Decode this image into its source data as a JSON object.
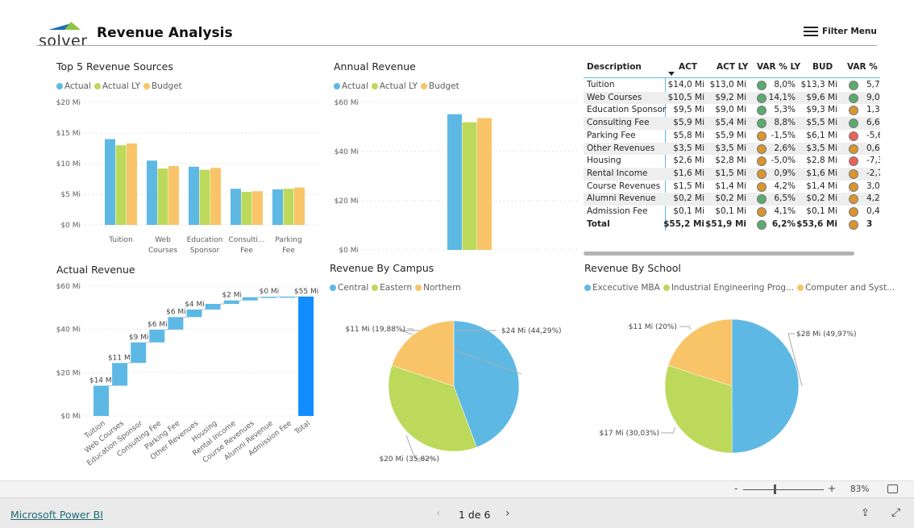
{
  "header": {
    "logo_text": "solver",
    "title": "Revenue Analysis",
    "filter_menu": "Filter Menu"
  },
  "colors": {
    "actual": "#5db9e4",
    "actual_ly": "#bdd95b",
    "budget": "#f9c468",
    "total": "#118dff",
    "green": "#5aab6e",
    "orange": "#d9952e",
    "red": "#e8635a"
  },
  "top5": {
    "title": "Top 5 Revenue Sources",
    "legend": [
      "Actual",
      "Actual LY",
      "Budget"
    ]
  },
  "annual": {
    "title": "Annual Revenue",
    "legend": [
      "Actual",
      "Actual LY",
      "Budget"
    ]
  },
  "waterfall": {
    "title": "Actual Revenue"
  },
  "campus": {
    "title": "Revenue By Campus",
    "legend": [
      "Central",
      "Eastern",
      "Northern"
    ]
  },
  "school": {
    "title": "Revenue By School",
    "legend": [
      "Excecutive MBA",
      "Industrial Engineering Prog...",
      "Computer and Syst..."
    ]
  },
  "chart_data": [
    {
      "type": "bar",
      "title": "Top 5 Revenue Sources",
      "categories": [
        [
          "Tuition"
        ],
        [
          "Web",
          "Courses"
        ],
        [
          "Education",
          "Sponsor"
        ],
        [
          "Consulti...",
          "Fee"
        ],
        [
          "Parking",
          "Fee"
        ]
      ],
      "series": [
        {
          "name": "Actual",
          "values": [
            14.0,
            10.5,
            9.5,
            5.9,
            5.8
          ]
        },
        {
          "name": "Actual LY",
          "values": [
            13.0,
            9.2,
            9.0,
            5.4,
            5.9
          ]
        },
        {
          "name": "Budget",
          "values": [
            13.3,
            9.6,
            9.3,
            5.5,
            6.1
          ]
        }
      ],
      "yticks": [
        "$0 Mi",
        "$5 Mi",
        "$10 Mi",
        "$15 Mi",
        "$20 Mi"
      ],
      "ylim": [
        0,
        20
      ],
      "grid": true,
      "legend": "top-left"
    },
    {
      "type": "bar",
      "title": "Annual Revenue",
      "categories": [
        ""
      ],
      "series": [
        {
          "name": "Actual",
          "values": [
            55.2
          ]
        },
        {
          "name": "Actual LY",
          "values": [
            51.9
          ]
        },
        {
          "name": "Budget",
          "values": [
            53.6
          ]
        }
      ],
      "yticks": [
        "$0 Mi",
        "$20 Mi",
        "$40 Mi",
        "$60 Mi"
      ],
      "ylim": [
        0,
        60
      ],
      "grid": true,
      "legend": "top-left"
    },
    {
      "type": "waterfall",
      "title": "Actual Revenue",
      "categories": [
        "Tuition",
        "Web Courses",
        "Education Sponsor",
        "Consulting Fee",
        "Parking Fee",
        "Other Revenues",
        "Housing",
        "Rental Income",
        "Course Revenues",
        "Alumni Revenue",
        "Admission Fee",
        "Total"
      ],
      "values": [
        14.0,
        10.5,
        9.5,
        5.9,
        5.8,
        3.5,
        2.6,
        1.6,
        1.5,
        0.2,
        0.1,
        55.2
      ],
      "labels": [
        "$14 Mi",
        "$11 Mi",
        "$9 Mi",
        "$6 Mi",
        "$6 Mi",
        "$4 Mi",
        "",
        "$2 Mi",
        "",
        "$0 Mi",
        "",
        "$55 Mi"
      ],
      "yticks": [
        "$0 Mi",
        "$20 Mi",
        "$40 Mi",
        "$60 Mi"
      ],
      "ylim": [
        0,
        60
      ],
      "grid": true
    },
    {
      "type": "pie",
      "title": "Revenue By Campus",
      "slices": [
        {
          "name": "Central",
          "value": 24,
          "percent": 44.29,
          "label": "$24 Mi (44,29%)"
        },
        {
          "name": "Eastern",
          "value": 20,
          "percent": 35.82,
          "label": "$20 Mi (35,82%)"
        },
        {
          "name": "Northern",
          "value": 11,
          "percent": 19.88,
          "label": "$11 Mi (19,88%)"
        }
      ],
      "legend": "top-left"
    },
    {
      "type": "pie",
      "title": "Revenue By School",
      "slices": [
        {
          "name": "Excecutive MBA",
          "value": 28,
          "percent": 49.97,
          "label": "$28 Mi (49,97%)"
        },
        {
          "name": "Industrial Engineering Prog...",
          "value": 17,
          "percent": 30.03,
          "label": "$17 Mi (30,03%)"
        },
        {
          "name": "Computer and Syst...",
          "value": 11,
          "percent": 20,
          "label": "$11 Mi (20%)"
        }
      ],
      "legend": "top-left"
    }
  ],
  "table": {
    "headers": [
      "Description",
      "ACT",
      "ACT LY",
      "VAR % LY",
      "BUD",
      "VAR % B"
    ],
    "rows": [
      {
        "desc": "Tuition",
        "act": "$14,0 Mi",
        "act_ly": "$13,0 Mi",
        "ly_status": "green",
        "var_ly": "8,0%",
        "bud": "$13,3 Mi",
        "b_status": "green",
        "var_b": "5,7"
      },
      {
        "desc": "Web Courses",
        "act": "$10,5 Mi",
        "act_ly": "$9,2 Mi",
        "ly_status": "green",
        "var_ly": "14,1%",
        "bud": "$9,6 Mi",
        "b_status": "green",
        "var_b": "9,0"
      },
      {
        "desc": "Education Sponsor",
        "act": "$9,5 Mi",
        "act_ly": "$9,0 Mi",
        "ly_status": "green",
        "var_ly": "5,3%",
        "bud": "$9,3 Mi",
        "b_status": "orange",
        "var_b": "1,3"
      },
      {
        "desc": "Consulting Fee",
        "act": "$5,9 Mi",
        "act_ly": "$5,4 Mi",
        "ly_status": "green",
        "var_ly": "8,8%",
        "bud": "$5,5 Mi",
        "b_status": "green",
        "var_b": "6,6"
      },
      {
        "desc": "Parking Fee",
        "act": "$5,8 Mi",
        "act_ly": "$5,9 Mi",
        "ly_status": "orange",
        "var_ly": "-1,5%",
        "bud": "$6,1 Mi",
        "b_status": "red",
        "var_b": "-5,6"
      },
      {
        "desc": "Other Revenues",
        "act": "$3,5 Mi",
        "act_ly": "$3,5 Mi",
        "ly_status": "orange",
        "var_ly": "2,6%",
        "bud": "$3,5 Mi",
        "b_status": "orange",
        "var_b": "0,6"
      },
      {
        "desc": "Housing",
        "act": "$2,6 Mi",
        "act_ly": "$2,8 Mi",
        "ly_status": "orange",
        "var_ly": "-5,0%",
        "bud": "$2,8 Mi",
        "b_status": "red",
        "var_b": "-7,3"
      },
      {
        "desc": "Rental Income",
        "act": "$1,6 Mi",
        "act_ly": "$1,5 Mi",
        "ly_status": "orange",
        "var_ly": "0,9%",
        "bud": "$1,6 Mi",
        "b_status": "orange",
        "var_b": "-2,7"
      },
      {
        "desc": "Course Revenues",
        "act": "$1,5 Mi",
        "act_ly": "$1,4 Mi",
        "ly_status": "orange",
        "var_ly": "4,2%",
        "bud": "$1,4 Mi",
        "b_status": "orange",
        "var_b": "3,0"
      },
      {
        "desc": "Alumni Revenue",
        "act": "$0,2 Mi",
        "act_ly": "$0,2 Mi",
        "ly_status": "green",
        "var_ly": "6,5%",
        "bud": "$0,2 Mi",
        "b_status": "orange",
        "var_b": "4,2"
      },
      {
        "desc": "Admission Fee",
        "act": "$0,1 Mi",
        "act_ly": "$0,1 Mi",
        "ly_status": "orange",
        "var_ly": "4,1%",
        "bud": "$0,1 Mi",
        "b_status": "orange",
        "var_b": "0,4"
      }
    ],
    "total": {
      "desc": "Total",
      "act": "$55,2 Mi",
      "act_ly": "$51,9 Mi",
      "ly_status": "green",
      "var_ly": "6,2%",
      "bud": "$53,6 Mi",
      "b_status": "orange",
      "var_b": "3"
    }
  },
  "zoom": {
    "minus": "-",
    "plus": "+",
    "level": "83%",
    "level_value": 83
  },
  "footer": {
    "link": "Microsoft Power BI",
    "page": "1 de 6"
  }
}
